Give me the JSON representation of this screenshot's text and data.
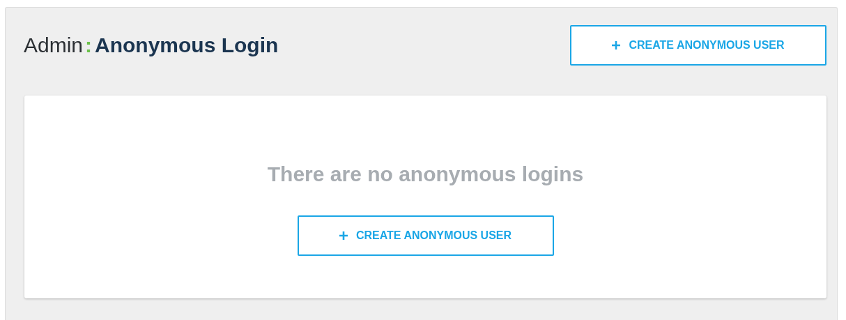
{
  "header": {
    "section": "Admin",
    "separator": ":",
    "title": "Anonymous Login",
    "button": "CREATE ANONYMOUS USER"
  },
  "empty_state": {
    "message": "There are no anonymous logins",
    "button": "CREATE ANONYMOUS USER"
  }
}
